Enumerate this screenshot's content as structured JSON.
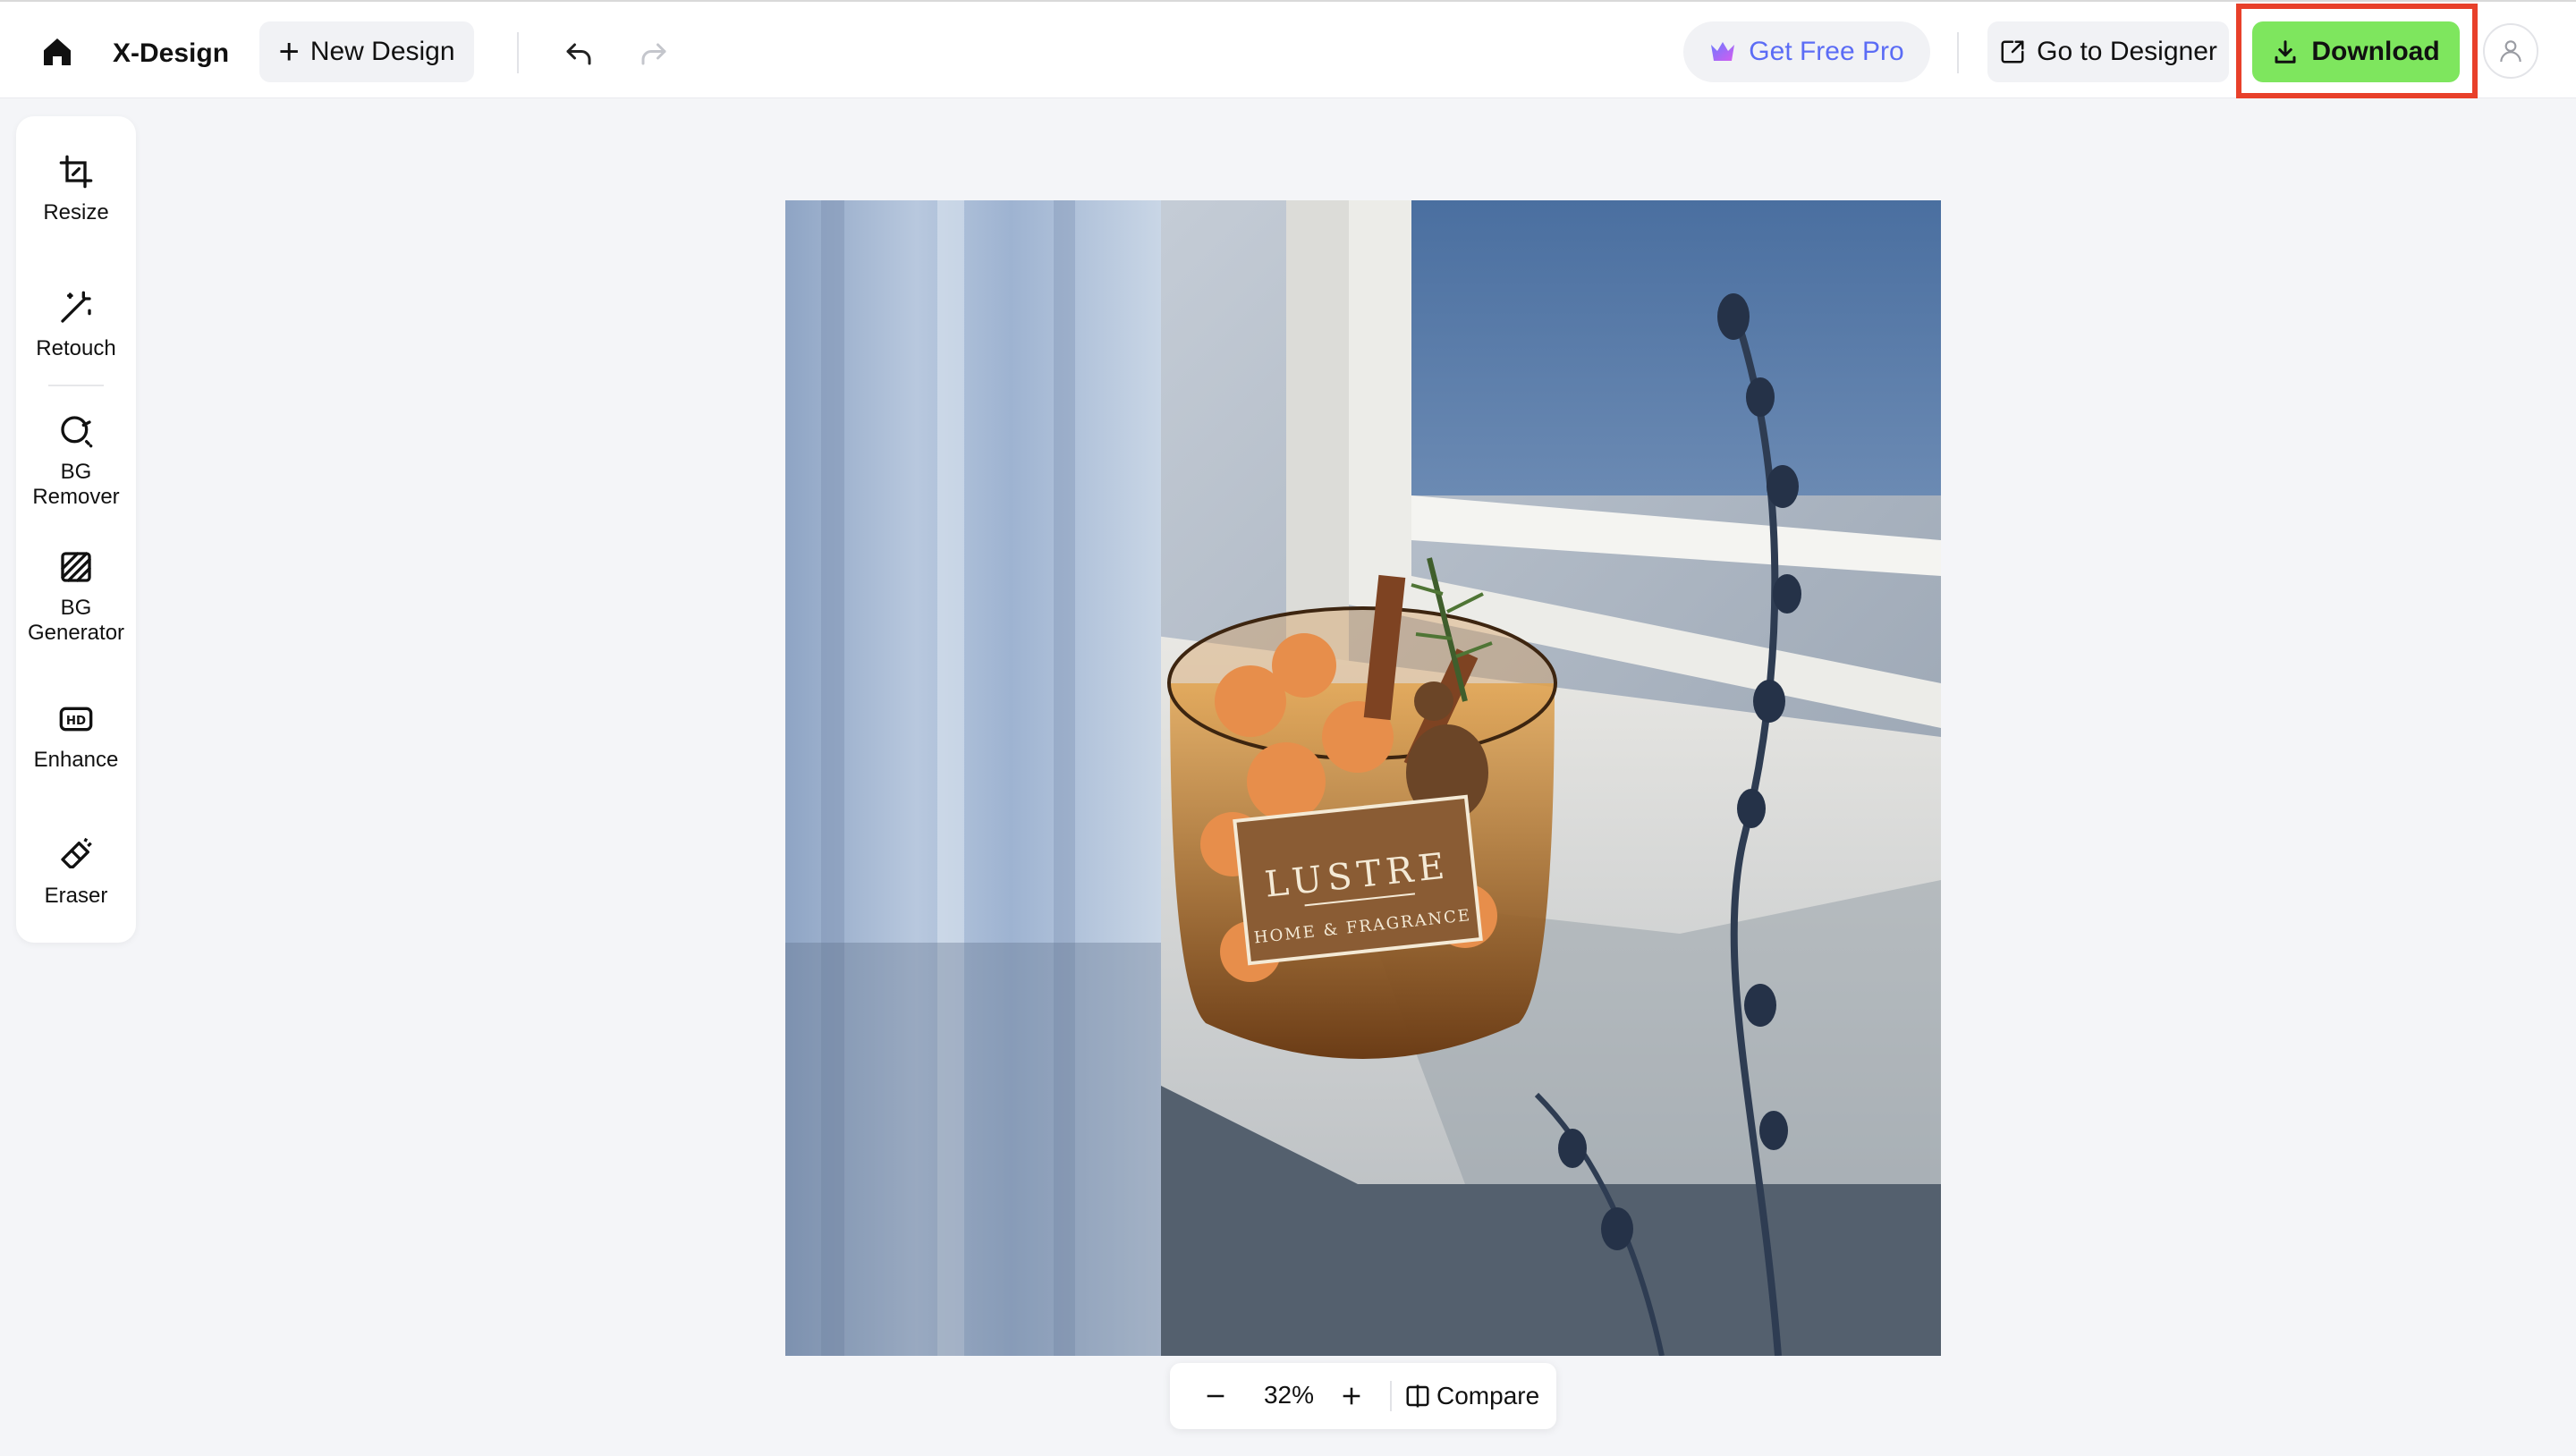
{
  "app": {
    "name": "X-Design"
  },
  "header": {
    "new_design_label": "New Design",
    "get_pro_label": "Get Free Pro",
    "go_to_designer_label": "Go to Designer",
    "download_label": "Download"
  },
  "tools": [
    {
      "label": "Resize",
      "icon": "crop-icon"
    },
    {
      "label": "Retouch",
      "icon": "magic-wand-icon"
    },
    {
      "label": "BG\nRemover",
      "icon": "bg-remover-icon"
    },
    {
      "label": "BG\nGenerator",
      "icon": "bg-generator-icon"
    },
    {
      "label": "Enhance",
      "icon": "hd-icon"
    },
    {
      "label": "Eraser",
      "icon": "eraser-icon"
    }
  ],
  "canvas": {
    "label_brand": "LUSTRE",
    "label_sub": "HOME & FRAGRANCE"
  },
  "zoom": {
    "level": "32%",
    "compare_label": "Compare"
  },
  "colors": {
    "download_bg": "#7ee65e",
    "pro_text": "#5b6cf5",
    "highlight": "#e8402a"
  }
}
